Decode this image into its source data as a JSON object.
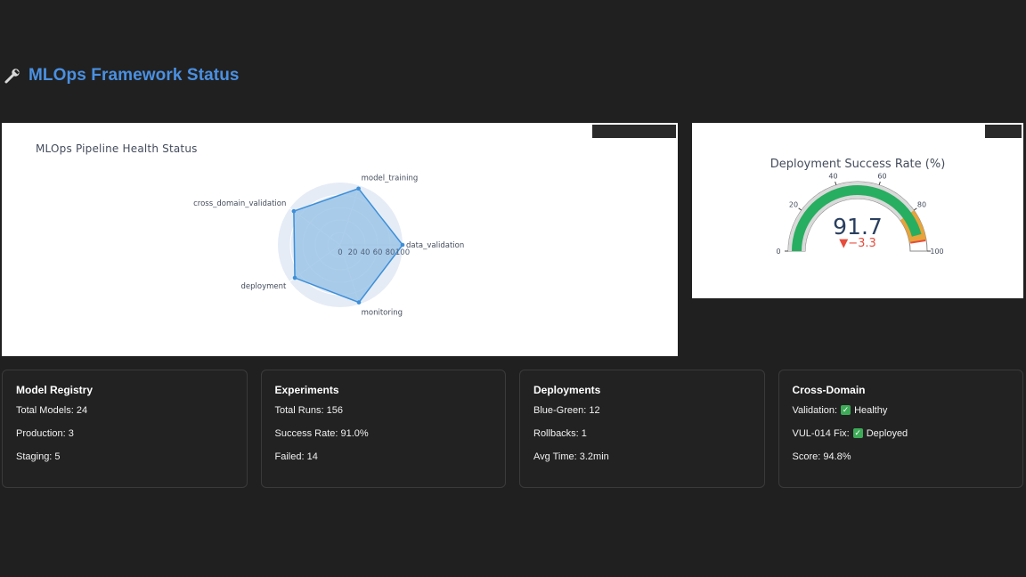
{
  "header": {
    "title": "MLOps Framework Status",
    "icon": "wrench-icon"
  },
  "radar": {
    "title": "MLOps Pipeline Health Status",
    "fill_color": "#9ec5e8",
    "line_color": "#3d8fd8",
    "chart_data": {
      "type": "radar",
      "categories": [
        "data_validation",
        "model_training",
        "cross_domain_validation",
        "deployment",
        "monitoring"
      ],
      "values": [
        100,
        95,
        92,
        90,
        97
      ],
      "radial_ticks": [
        "0",
        "20",
        "40",
        "60",
        "80",
        "100"
      ],
      "range": [
        0,
        100
      ]
    }
  },
  "gauge": {
    "title": "Deployment Success Rate (%)",
    "value_text": "91.7",
    "delta_text": "▼−3.3",
    "bar_color": "#27ae60",
    "threshold_color": "#e8a33a",
    "delta_color": "#e74c3c",
    "chart_data": {
      "type": "gauge",
      "value": 91.7,
      "delta": -3.3,
      "range": [
        0,
        100
      ],
      "ticks": [
        "0",
        "20",
        "40",
        "60",
        "80",
        "100"
      ],
      "steps": [
        {
          "from": 0,
          "to": 80,
          "color": "#d9d9d9"
        },
        {
          "from": 80,
          "to": 95,
          "color": "#e8a33a"
        }
      ],
      "threshold": 95
    }
  },
  "cards": [
    {
      "title": "Model Registry",
      "rows": [
        "Total Models: 24",
        "Production: 3",
        "Staging: 5"
      ]
    },
    {
      "title": "Experiments",
      "rows": [
        "Total Runs: 156",
        "Success Rate: 91.0%",
        "Failed: 14"
      ]
    },
    {
      "title": "Deployments",
      "rows": [
        "Blue-Green: 12",
        "Rollbacks: 1",
        "Avg Time: 3.2min"
      ]
    },
    {
      "title": "Cross-Domain",
      "validation_label": "Validation:",
      "validation_status": "Healthy",
      "vul_label": "VUL-014 Fix:",
      "vul_status": "Deployed",
      "score": "Score: 94.8%"
    }
  ]
}
